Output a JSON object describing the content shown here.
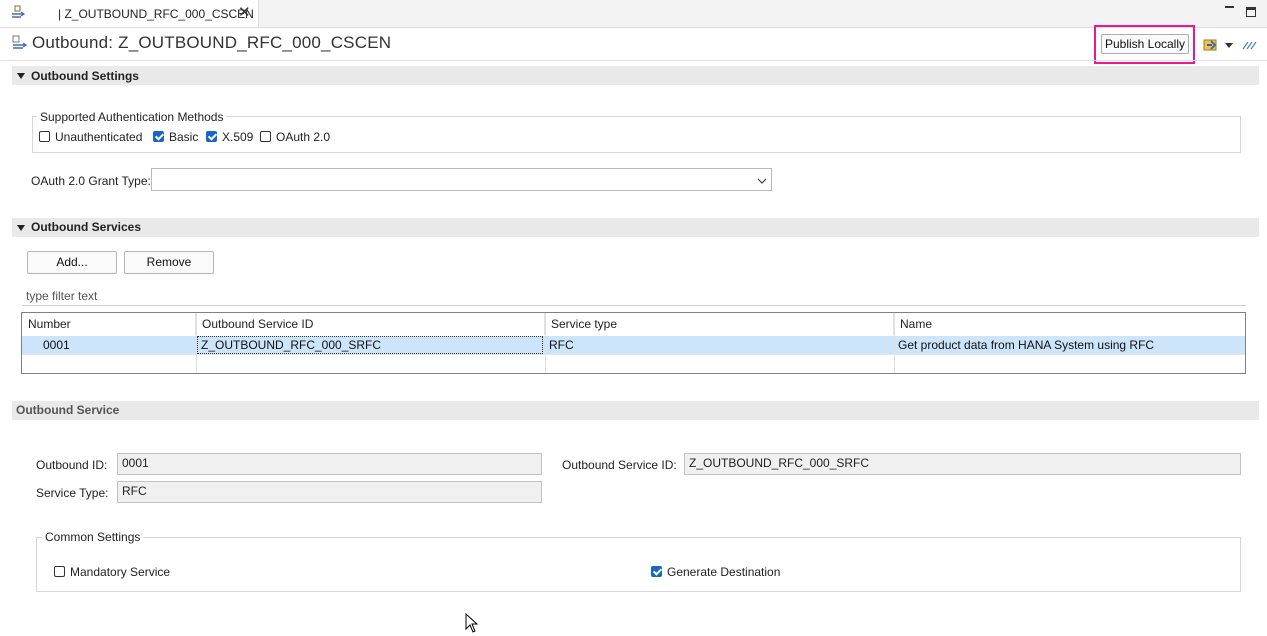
{
  "tab": {
    "title": "| Z_OUTBOUND_RFC_000_CSCEN"
  },
  "header": {
    "title": "Outbound: Z_OUTBOUND_RFC_000_CSCEN",
    "publish_label": "Publish Locally",
    "highlight_color": "#e81a8e"
  },
  "outbound_settings": {
    "section_title": "Outbound Settings",
    "auth_group_label": "Supported Authentication Methods",
    "auth_methods": [
      {
        "label": "Unauthenticated",
        "checked": false
      },
      {
        "label": "Basic",
        "checked": true
      },
      {
        "label": "X.509",
        "checked": true
      },
      {
        "label": "OAuth 2.0",
        "checked": false
      }
    ],
    "grant_type_label": "OAuth 2.0 Grant Type:",
    "grant_type_value": ""
  },
  "outbound_services": {
    "section_title": "Outbound Services",
    "add_label": "Add...",
    "remove_label": "Remove",
    "filter_placeholder": "type filter text",
    "columns": [
      "Number",
      "Outbound Service ID",
      "Service type",
      "Name"
    ],
    "rows": [
      {
        "number": "0001",
        "service_id": "Z_OUTBOUND_RFC_000_SRFC",
        "service_type": "RFC",
        "name": "Get product data from HANA System using RFC"
      }
    ]
  },
  "outbound_service": {
    "section_title": "Outbound Service",
    "outbound_id_label": "Outbound ID:",
    "outbound_id_value": "0001",
    "service_id_label": "Outbound Service ID:",
    "service_id_value": "Z_OUTBOUND_RFC_000_SRFC",
    "service_type_label": "Service Type:",
    "service_type_value": "RFC",
    "common_settings_label": "Common Settings",
    "mandatory_label": "Mandatory Service",
    "mandatory_checked": false,
    "generate_dest_label": "Generate Destination",
    "generate_dest_checked": true
  },
  "colors": {
    "accent_blue": "#1768c4",
    "selection": "#cce5fa",
    "section_bg": "#e9e9e9"
  }
}
